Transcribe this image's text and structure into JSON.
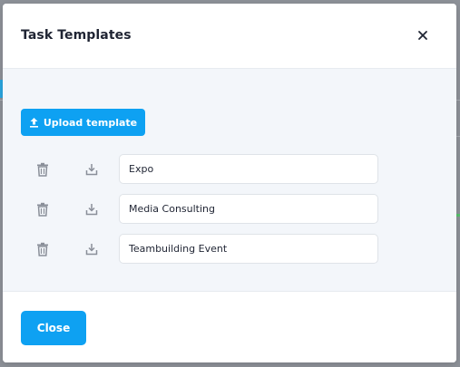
{
  "dialog": {
    "title": "Task Templates",
    "upload_label": "Upload template",
    "close_label": "Close"
  },
  "templates": [
    {
      "name": "Expo"
    },
    {
      "name": "Media Consulting"
    },
    {
      "name": "Teambuilding Event"
    }
  ],
  "colors": {
    "accent": "#0ea1f2",
    "title_text": "#1f2433",
    "body_background": "#f3f6fa",
    "icon_gray": "#8a8f99"
  },
  "icons": {
    "close": "close-icon",
    "upload": "upload-icon",
    "delete": "trash-icon",
    "download": "download-icon"
  }
}
